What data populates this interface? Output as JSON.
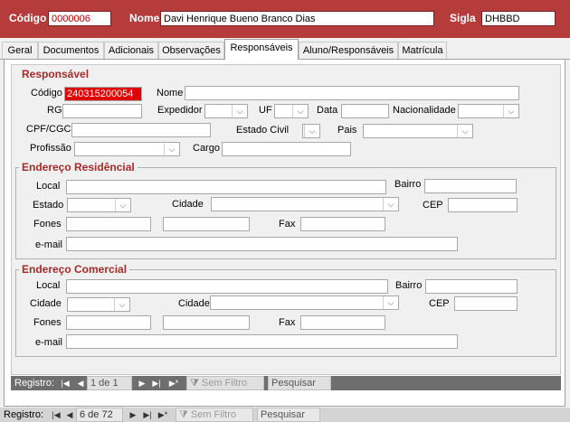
{
  "header": {
    "codigo_label": "Código",
    "codigo_value": "0000006",
    "nome_label": "Nome",
    "nome_value": "Davi Henrique Bueno Branco Dias",
    "sigla_label": "Sigla",
    "sigla_value": "DHBBD"
  },
  "tabs": [
    {
      "label": "Geral"
    },
    {
      "label": "Documentos"
    },
    {
      "label": "Adicionais"
    },
    {
      "label": "Observações"
    },
    {
      "label": "Responsáveis"
    },
    {
      "label": "Aluno/Responsáveis"
    },
    {
      "label": "Matrícula"
    }
  ],
  "responsavel": {
    "section_title": "Responsável",
    "codigo_label": "Código",
    "codigo_value": "240315200054",
    "nome_label": "Nome",
    "nome_value": "",
    "rg_label": "RG",
    "expedidor_label": "Expedidor",
    "uf_label": "UF",
    "data_label": "Data",
    "nacionalidade_label": "Nacionalidade",
    "cpf_label": "CPF/CGC",
    "estado_civil_label": "Estado Civil",
    "pais_label": "Pais",
    "profissao_label": "Profissão",
    "cargo_label": "Cargo"
  },
  "endereco_residencial": {
    "title": "Endereço Residêncial",
    "local_label": "Local",
    "bairro_label": "Bairro",
    "estado_label": "Estado",
    "cidade_label": "Cidade",
    "cep_label": "CEP",
    "fones_label": "Fones",
    "fax_label": "Fax",
    "email_label": "e-mail"
  },
  "endereco_comercial": {
    "title": "Endereço Comercial",
    "local_label": "Local",
    "bairro_label": "Bairro",
    "cidade_label": "Cidade",
    "cidade2_label": "Cidade",
    "cep_label": "CEP",
    "fones_label": "Fones",
    "fax_label": "Fax",
    "email_label": "e-mail"
  },
  "inner_nav": {
    "label": "Registro:",
    "position": "1 de 1",
    "filter": "Sem Filtro",
    "search": "Pesquisar"
  },
  "outer_nav": {
    "label": "Registro:",
    "position": "6 de 72",
    "filter": "Sem Filtro",
    "search": "Pesquisar"
  },
  "colors": {
    "header_bg": "#b63c3c",
    "section_title": "#a52a2a",
    "highlight": "#e00000",
    "nav_bg": "#6e6e6e"
  }
}
